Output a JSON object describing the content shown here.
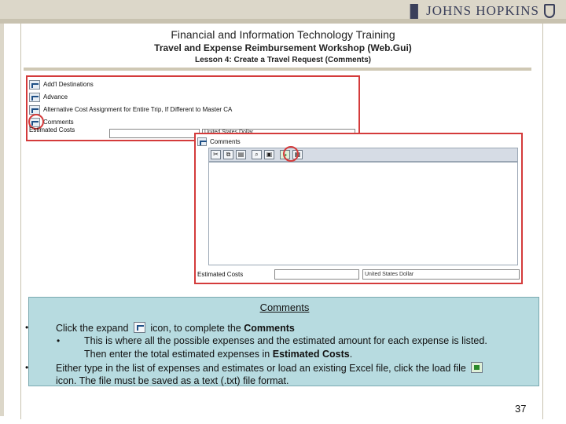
{
  "brand": {
    "mark": "▐▌",
    "name": "JOHNS HOPKINS"
  },
  "header": {
    "line1": "Financial and Information Technology Training",
    "line2": "Travel and Expense Reimbursement Workshop (Web.Gui)",
    "line3": "Lesson 4: Create a Travel Request (Comments)"
  },
  "screen1": {
    "items": [
      {
        "label": "Add'l Destinations",
        "icon": "expand-folder-icon"
      },
      {
        "label": "Advance",
        "icon": "expand-folder-icon"
      },
      {
        "label": "Alternative Cost Assignment for Entire Trip, If Different to Master CA",
        "icon": "expand-folder-icon"
      },
      {
        "label": "Comments",
        "icon": "expand-folder-icon"
      }
    ],
    "estimated_label": "Estimated Costs",
    "currency": "United States Dollar"
  },
  "screen2": {
    "title": "Comments",
    "toolbar": [
      "cut-icon",
      "copy-icon",
      "paste-icon",
      "find-icon",
      "save-icon",
      "load-file-icon",
      "insert-icon"
    ],
    "estimated_label": "Estimated Costs",
    "currency": "United States Dollar"
  },
  "panel": {
    "title": "Comments",
    "b1_pre": "Click the expand",
    "b1_post": "icon, to complete the",
    "b1_bold": "Comments",
    "sub1": "This is where all the possible expenses and the estimated amount for each expense is listed.",
    "sub2_pre": "Then enter the total estimated expenses in",
    "sub2_bold": "Estimated Costs",
    "sub2_post": ".",
    "b2_line1": "Either type in the list of expenses and estimates or load an existing Excel file, click the load file",
    "b2_line2": "icon. The file must be saved as a text (.txt) file format."
  },
  "page_number": "37"
}
